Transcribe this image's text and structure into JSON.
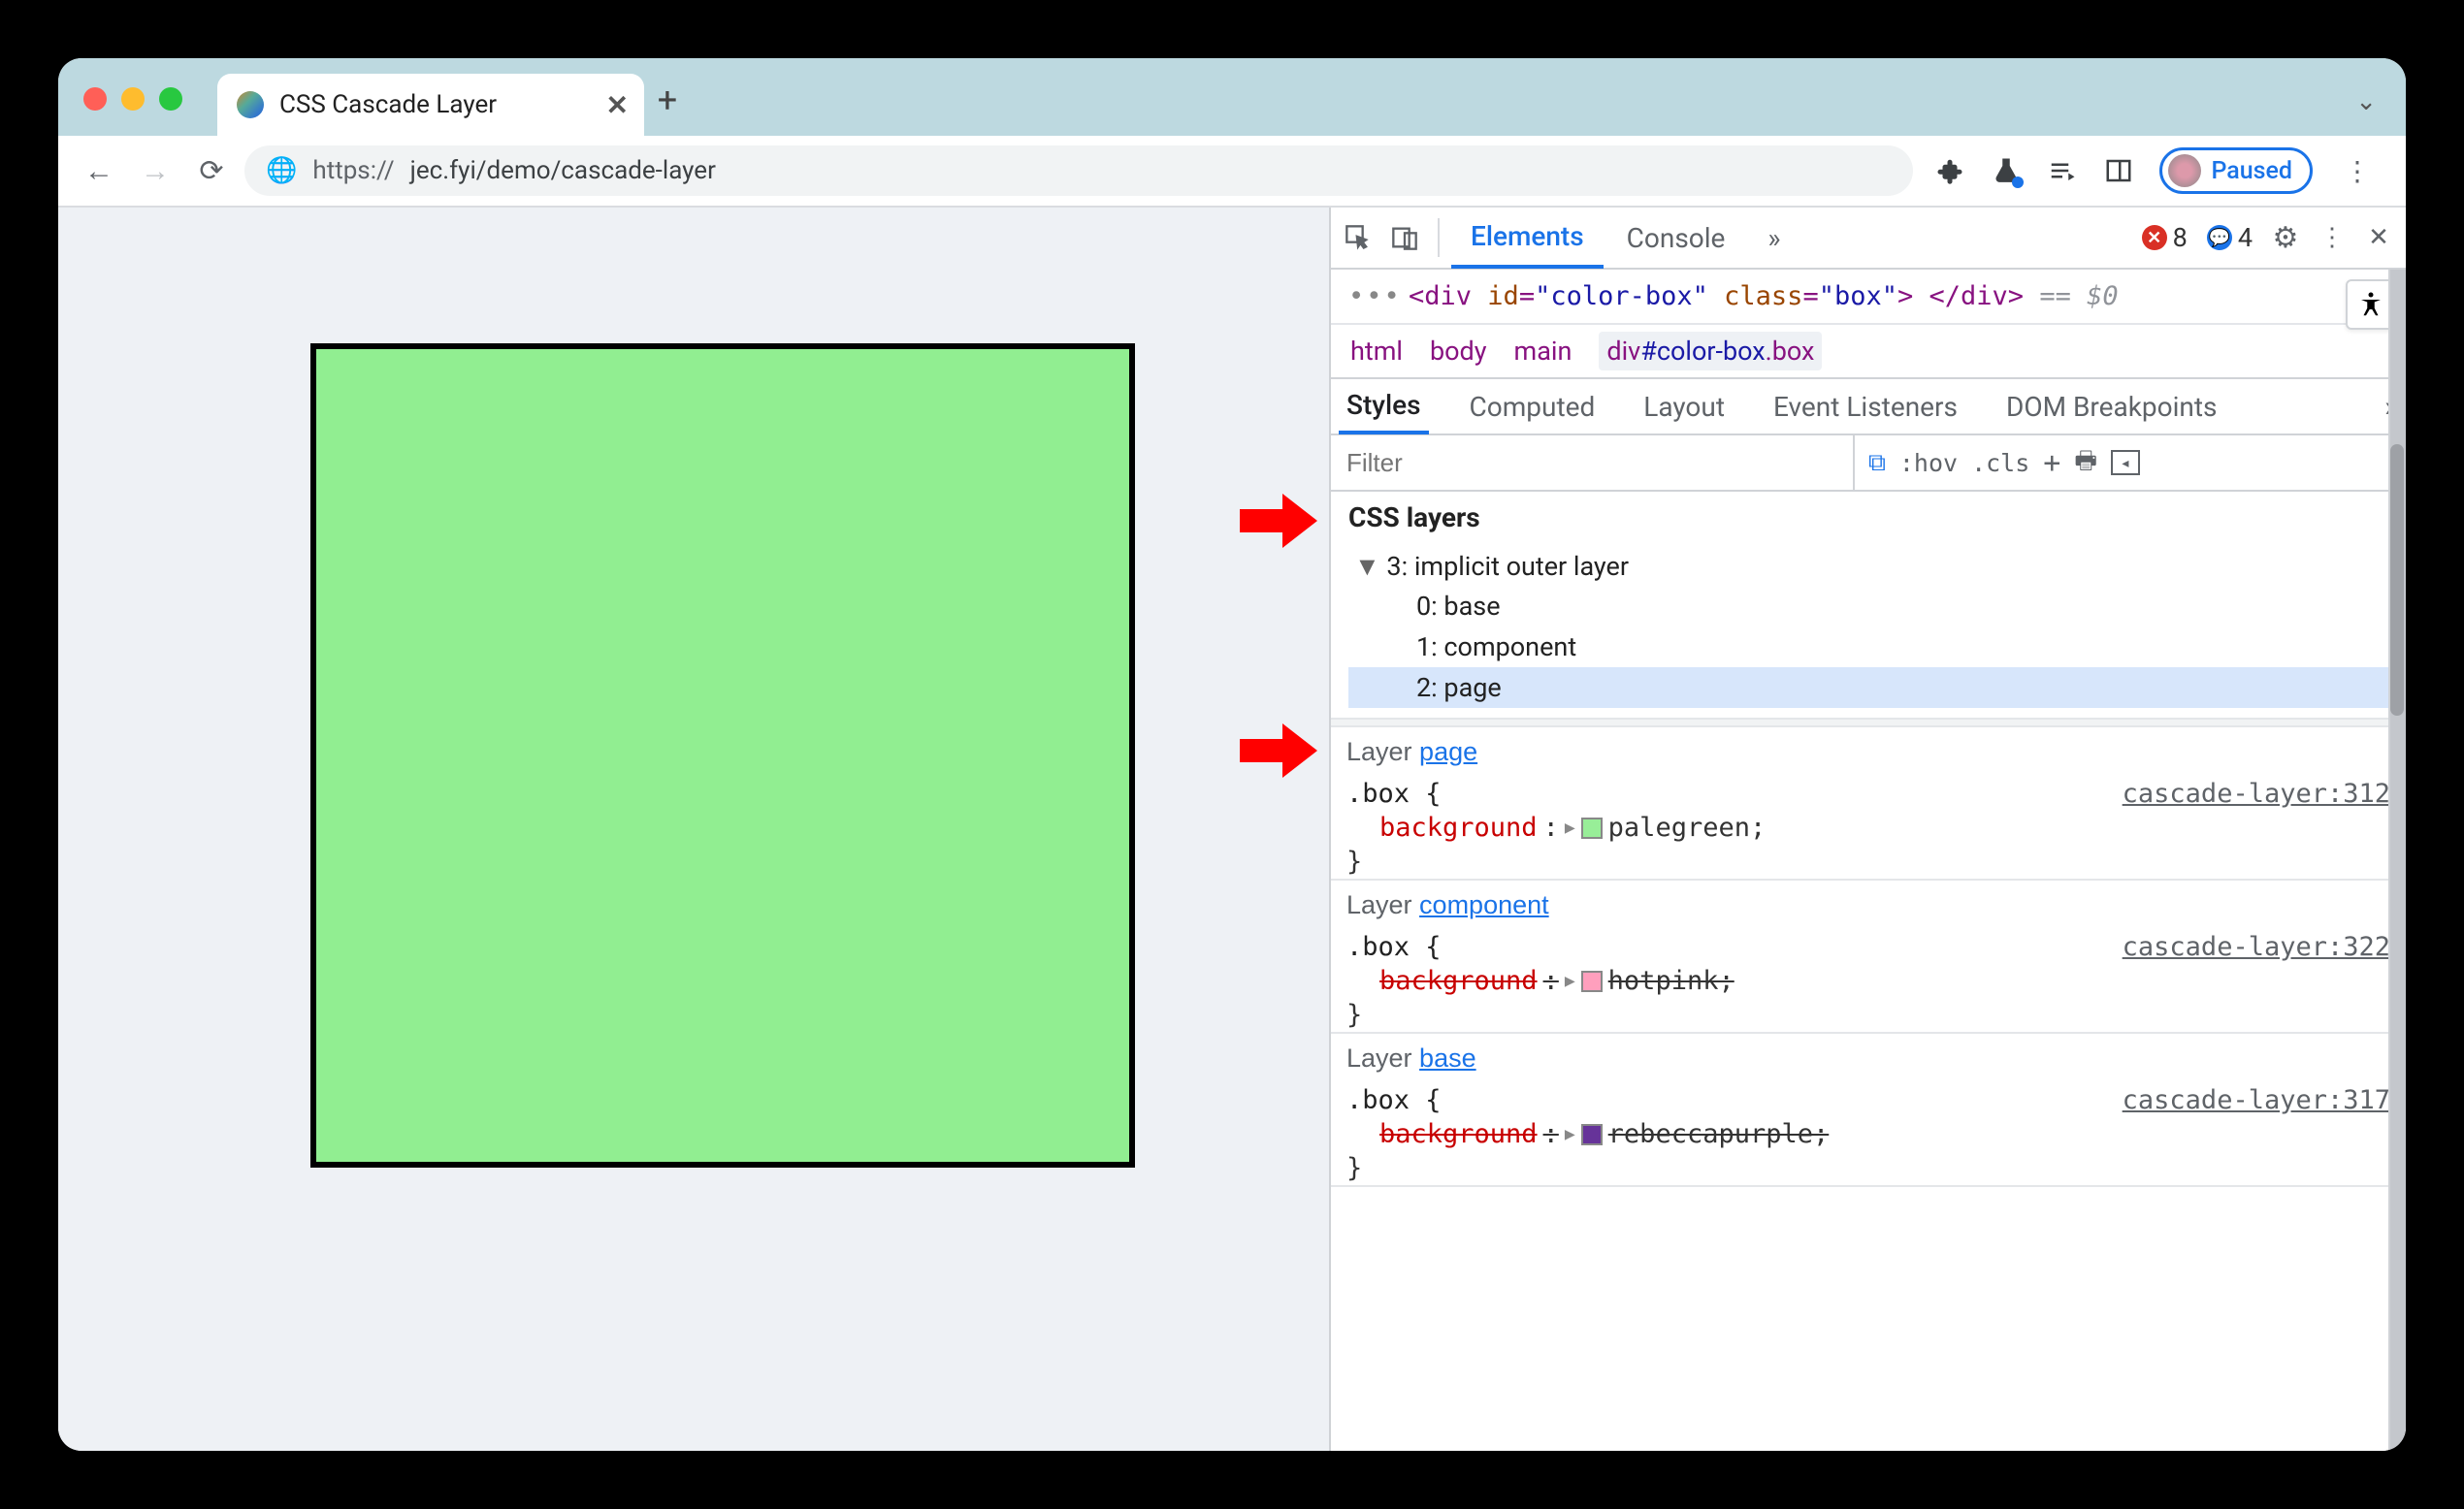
{
  "tab": {
    "title": "CSS Cascade Layer"
  },
  "address": {
    "protocol": "https://",
    "url": "jec.fyi/demo/cascade-layer"
  },
  "paused_label": "Paused",
  "devtools": {
    "tabs": {
      "elements": "Elements",
      "console": "Console"
    },
    "errors": "8",
    "messages": "4",
    "dom": {
      "open": "<div",
      "id_attr": "id",
      "id_val": "\"color-box\"",
      "class_attr": "class",
      "class_val": "\"box\"",
      "close_open": ">",
      "closetag": "</div>",
      "dollar": "== $0"
    },
    "crumb": {
      "a": "html",
      "b": "body",
      "c": "main",
      "d_pre": "div",
      "d_id": "#color-box",
      "d_cls": ".box"
    },
    "styles_tabs": {
      "a": "Styles",
      "b": "Computed",
      "c": "Layout",
      "d": "Event Listeners",
      "e": "DOM Breakpoints"
    },
    "filter_placeholder": "Filter",
    "hov": ":hov",
    "cls": ".cls",
    "layers_header": "CSS layers",
    "tree": {
      "root": "3: implicit outer layer",
      "c0": "0: base",
      "c1": "1: component",
      "c2": "2: page"
    },
    "rules": [
      {
        "layer_label": "Layer ",
        "layer_link": "page",
        "selector": ".box {",
        "source": "cascade-layer:312",
        "prop_name": "background",
        "value": "palegreen;",
        "swatch": "#98ee98",
        "overridden": false
      },
      {
        "layer_label": "Layer ",
        "layer_link": "component",
        "selector": ".box {",
        "source": "cascade-layer:322",
        "prop_name": "background",
        "value": "hotpink;",
        "swatch": "#ff9fbd",
        "overridden": true
      },
      {
        "layer_label": "Layer ",
        "layer_link": "base",
        "selector": ".box {",
        "source": "cascade-layer:317",
        "prop_name": "background",
        "value": "rebeccapurple;",
        "swatch": "#663399",
        "overridden": true
      }
    ],
    "brace_close": "}"
  }
}
